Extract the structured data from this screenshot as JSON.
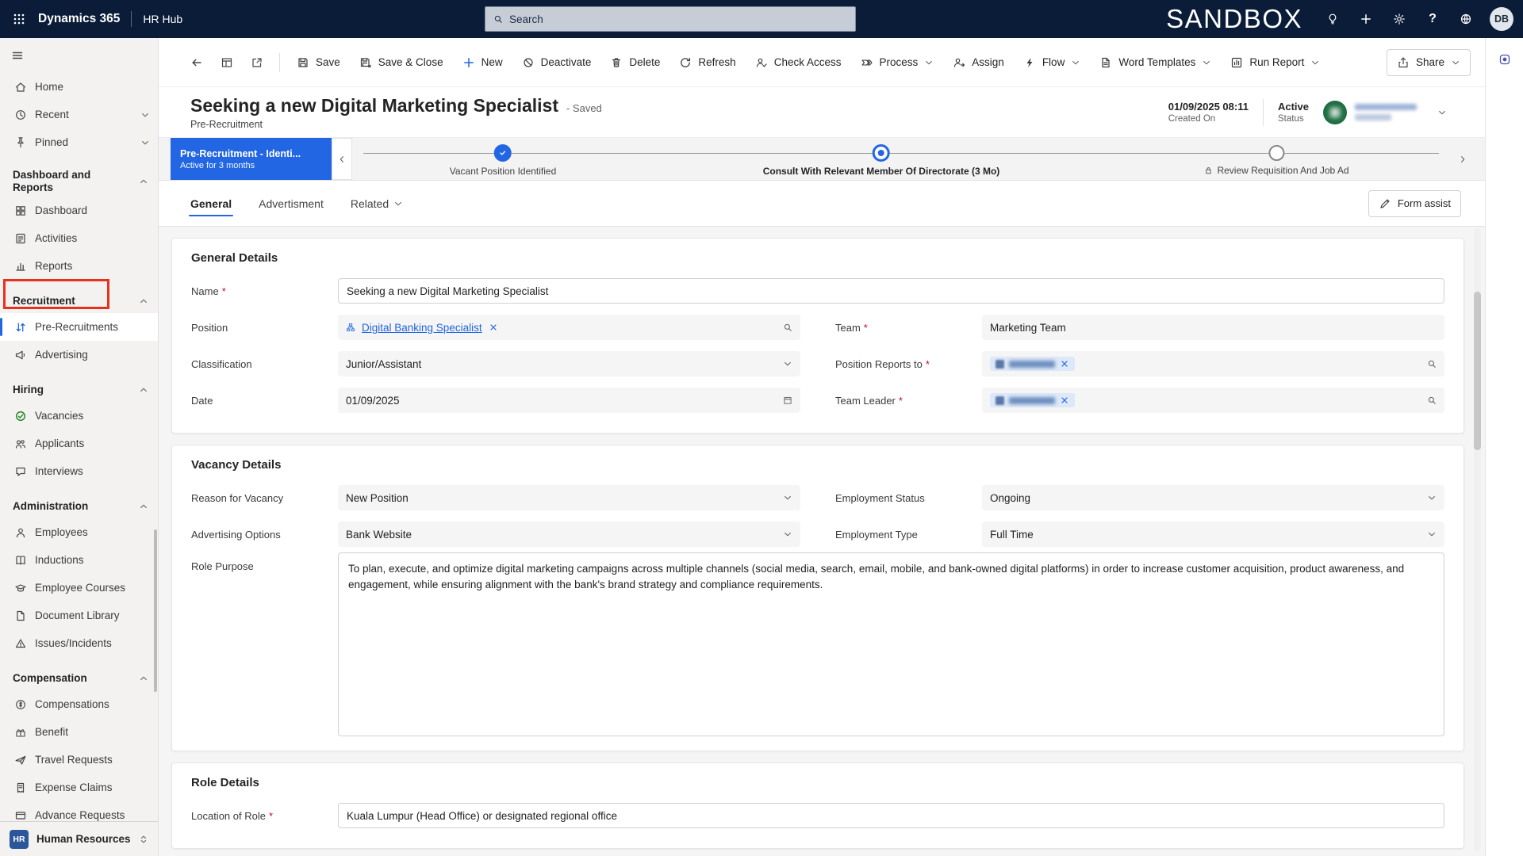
{
  "topbar": {
    "app_name": "Dynamics 365",
    "area_name": "HR Hub",
    "search_placeholder": "Search",
    "environment_badge": "SANDBOX",
    "help_label": "?",
    "avatar_initials": "DB"
  },
  "sidebar": {
    "items": [
      {
        "kind": "item",
        "label": "Home",
        "icon": "home"
      },
      {
        "kind": "item",
        "label": "Recent",
        "icon": "clock",
        "chevron": true
      },
      {
        "kind": "item",
        "label": "Pinned",
        "icon": "pin",
        "chevron": true
      },
      {
        "kind": "group",
        "label": "Dashboard and Reports"
      },
      {
        "kind": "item",
        "label": "Dashboard",
        "icon": "grid"
      },
      {
        "kind": "item",
        "label": "Activities",
        "icon": "tasks"
      },
      {
        "kind": "item",
        "label": "Reports",
        "icon": "chart"
      },
      {
        "kind": "group",
        "label": "Recruitment",
        "annotated": true
      },
      {
        "kind": "item",
        "label": "Pre-Recruitments",
        "icon": "sort",
        "selected": true
      },
      {
        "kind": "item",
        "label": "Advertising",
        "icon": "mega"
      },
      {
        "kind": "group",
        "label": "Hiring"
      },
      {
        "kind": "item",
        "label": "Vacancies",
        "icon": "checkcircle",
        "iconColor": "green"
      },
      {
        "kind": "item",
        "label": "Applicants",
        "icon": "people"
      },
      {
        "kind": "item",
        "label": "Interviews",
        "icon": "chat"
      },
      {
        "kind": "group",
        "label": "Administration"
      },
      {
        "kind": "item",
        "label": "Employees",
        "icon": "person"
      },
      {
        "kind": "item",
        "label": "Inductions",
        "icon": "book"
      },
      {
        "kind": "item",
        "label": "Employee Courses",
        "icon": "course"
      },
      {
        "kind": "item",
        "label": "Document Library",
        "icon": "doc"
      },
      {
        "kind": "item",
        "label": "Issues/Incidents",
        "icon": "warn"
      },
      {
        "kind": "group",
        "label": "Compensation"
      },
      {
        "kind": "item",
        "label": "Compensations",
        "icon": "money"
      },
      {
        "kind": "item",
        "label": "Benefit",
        "icon": "gift"
      },
      {
        "kind": "item",
        "label": "Travel Requests",
        "icon": "plane"
      },
      {
        "kind": "item",
        "label": "Expense Claims",
        "icon": "receipt"
      },
      {
        "kind": "item",
        "label": "Advance Requests",
        "icon": "card"
      }
    ],
    "area_switcher": {
      "badge": "HR",
      "label": "Human Resources"
    }
  },
  "commandbar": {
    "items": [
      {
        "label": "Save",
        "icon": "save"
      },
      {
        "label": "Save & Close",
        "icon": "saveclose"
      },
      {
        "label": "New",
        "icon": "plus",
        "blue": true
      },
      {
        "label": "Deactivate",
        "icon": "deactivate"
      },
      {
        "label": "Delete",
        "icon": "trash"
      },
      {
        "label": "Refresh",
        "icon": "refresh"
      },
      {
        "label": "Check Access",
        "icon": "checkaccess"
      },
      {
        "label": "Process",
        "icon": "process",
        "chevron": true
      },
      {
        "label": "Assign",
        "icon": "assign"
      },
      {
        "label": "Flow",
        "icon": "flow",
        "chevron": true
      },
      {
        "label": "Word Templates",
        "icon": "worddoc",
        "chevron": true
      },
      {
        "label": "Run Report",
        "icon": "report",
        "chevron": true
      }
    ],
    "share_label": "Share"
  },
  "record_header": {
    "title": "Seeking a new Digital Marketing Specialist",
    "save_status": "- Saved",
    "entity_type": "Pre-Recruitment",
    "created_on_value": "01/09/2025 08:11",
    "created_on_label": "Created On",
    "status_value": "Active",
    "status_label": "Status",
    "owner_redacted": true
  },
  "bpf": {
    "active_stage_title": "Pre-Recruitment - Identi...",
    "active_stage_subtitle": "Active for 3 months",
    "stages": [
      {
        "label": "Vacant Position Identified",
        "state": "completed"
      },
      {
        "label": "Consult With Relevant Member Of Directorate  (3 Mo)",
        "state": "current"
      },
      {
        "label": "Review Requisition And Job Ad",
        "state": "locked"
      }
    ]
  },
  "tabs": [
    {
      "label": "General",
      "active": true
    },
    {
      "label": "Advertisment"
    },
    {
      "label": "Related",
      "dropdown": true
    }
  ],
  "form_assist_label": "Form assist",
  "form": {
    "general": {
      "title": "General Details",
      "name_label": "Name",
      "name_value": "Seeking a new Digital Marketing Specialist",
      "position_label": "Position",
      "position_value": "Digital Banking Specialist",
      "classification_label": "Classification",
      "classification_value": "Junior/Assistant",
      "date_label": "Date",
      "date_value": "01/09/2025",
      "team_label": "Team",
      "team_value": "Marketing Team",
      "reports_label": "Position Reports to",
      "reports_redacted": true,
      "leader_label": "Team Leader",
      "leader_redacted": true
    },
    "vacancy": {
      "title": "Vacancy Details",
      "reason_label": "Reason for Vacancy",
      "reason_value": "New Position",
      "advertising_label": "Advertising Options",
      "advertising_value": "Bank Website",
      "purpose_label": "Role Purpose",
      "purpose_value": "To plan, execute, and optimize digital marketing campaigns across multiple channels (social media, search, email, mobile, and bank-owned digital platforms) in order to increase customer acquisition, product awareness, and engagement, while ensuring alignment with the bank's brand strategy and compliance requirements.",
      "status_label": "Employment Status",
      "status_value": "Ongoing",
      "type_label": "Employment Type",
      "type_value": "Full Time"
    },
    "role": {
      "title": "Role Details",
      "location_label": "Location of Role",
      "location_value": "Kuala Lumpur (Head Office) or designated regional office"
    }
  },
  "colors": {
    "accent": "#2266E3",
    "annotation_red": "#E8321E",
    "status_green": "#107C10",
    "topbar_bg": "#0A1C38"
  }
}
